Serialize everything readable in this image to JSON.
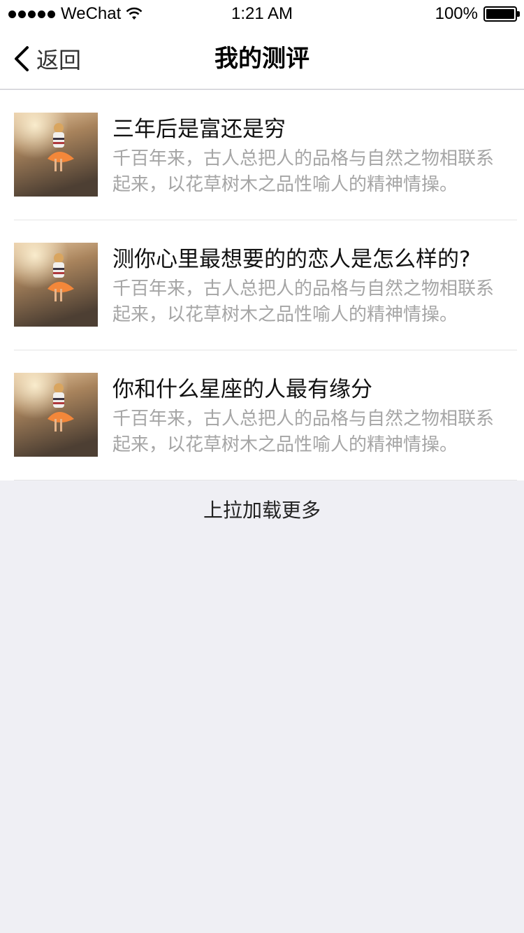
{
  "status_bar": {
    "carrier": "WeChat",
    "time": "1:21 AM",
    "battery": "100%"
  },
  "nav": {
    "back_label": "返回",
    "title": "我的测评"
  },
  "items": [
    {
      "title": "三年后是富还是穷",
      "description": "千百年来，古人总把人的品格与自然之物相联系起来，以花草树木之品性喻人的精神情操。"
    },
    {
      "title": "测你心里最想要的的恋人是怎么样的?",
      "description": "千百年来，古人总把人的品格与自然之物相联系起来，以花草树木之品性喻人的精神情操。"
    },
    {
      "title": "你和什么星座的人最有缘分",
      "description": "千百年来，古人总把人的品格与自然之物相联系起来，以花草树木之品性喻人的精神情操。"
    }
  ],
  "load_more": "上拉加载更多",
  "colors": {
    "background": "#efeff4",
    "card": "#ffffff",
    "title_text": "#111111",
    "desc_text": "#a5a5a5"
  }
}
